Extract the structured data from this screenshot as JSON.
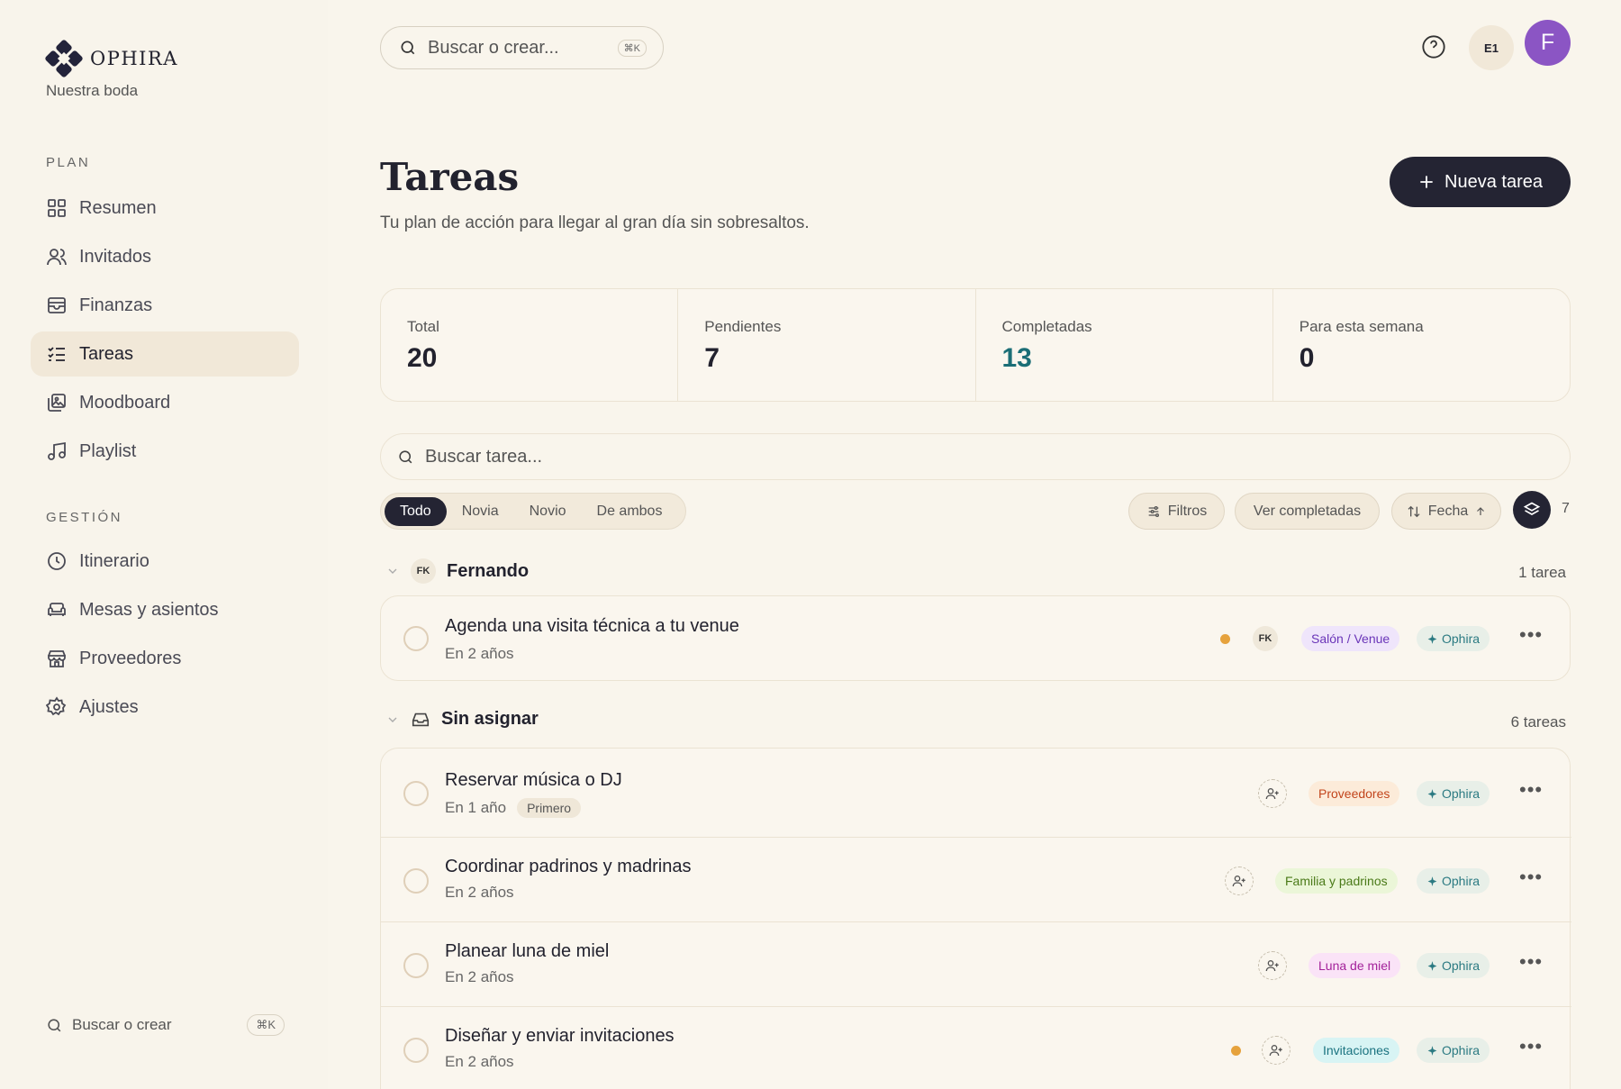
{
  "brand": {
    "name": "OPHIRA",
    "subtitle": "Nuestra boda"
  },
  "sidebar": {
    "section_plan": "PLAN",
    "section_gestion": "GESTIÓN",
    "items": [
      {
        "label": "Resumen",
        "icon": "grid-icon"
      },
      {
        "label": "Invitados",
        "icon": "users-icon"
      },
      {
        "label": "Finanzas",
        "icon": "wallet-icon"
      },
      {
        "label": "Tareas",
        "icon": "checklist-icon",
        "active": true
      },
      {
        "label": "Moodboard",
        "icon": "images-icon"
      },
      {
        "label": "Playlist",
        "icon": "music-icon"
      },
      {
        "label": "Itinerario",
        "icon": "clock-icon"
      },
      {
        "label": "Mesas y asientos",
        "icon": "sofa-icon"
      },
      {
        "label": "Proveedores",
        "icon": "store-icon"
      },
      {
        "label": "Ajustes",
        "icon": "gear-icon"
      }
    ],
    "search_label": "Buscar o crear",
    "search_kbd": "⌘K"
  },
  "header": {
    "search_placeholder": "Buscar o crear...",
    "search_kbd": "⌘K",
    "workspace_badge": "E1",
    "avatar_letter": "F"
  },
  "page": {
    "title": "Tareas",
    "subtitle": "Tu plan de acción para llegar al gran día sin sobresaltos.",
    "new_task_label": "Nueva tarea"
  },
  "stats": [
    {
      "label": "Total",
      "value": "20"
    },
    {
      "label": "Pendientes",
      "value": "7"
    },
    {
      "label": "Completadas",
      "value": "13",
      "color": "#1b6e76"
    },
    {
      "label": "Para esta semana",
      "value": "0"
    }
  ],
  "filters": {
    "search_placeholder": "Buscar tarea...",
    "segments": [
      "Todo",
      "Novia",
      "Novio",
      "De ambos"
    ],
    "active_segment": "Todo",
    "filters_label": "Filtros",
    "show_completed_label": "Ver completadas",
    "sort_label": "Fecha",
    "group_count": "7"
  },
  "groups": [
    {
      "name": "Fernando",
      "initials": "FK",
      "count_label": "1 tarea",
      "tasks": [
        {
          "title": "Agenda una visita técnica a tu venue",
          "due": "En 2 años",
          "assignee": "FK",
          "category": "Salón / Venue",
          "source": "Ophira",
          "priority_dot": true
        }
      ]
    },
    {
      "name": "Sin asignar",
      "count_label": "6 tareas",
      "tasks": [
        {
          "title": "Reservar música o DJ",
          "due": "En 1 año",
          "badge": "Primero",
          "category": "Proveedores",
          "source": "Ophira"
        },
        {
          "title": "Coordinar padrinos y madrinas",
          "due": "En 2 años",
          "category": "Familia y padrinos",
          "source": "Ophira"
        },
        {
          "title": "Planear luna de miel",
          "due": "En 2 años",
          "category": "Luna de miel",
          "source": "Ophira"
        },
        {
          "title": "Diseñar y enviar invitaciones",
          "due": "En 2 años",
          "category": "Invitaciones",
          "source": "Ophira",
          "priority_dot": true
        }
      ]
    }
  ],
  "colors": {
    "accent_dark": "#242433",
    "avatar": "#8b55c4",
    "teal": "#1b6e76",
    "priority": "#e6a23c"
  }
}
